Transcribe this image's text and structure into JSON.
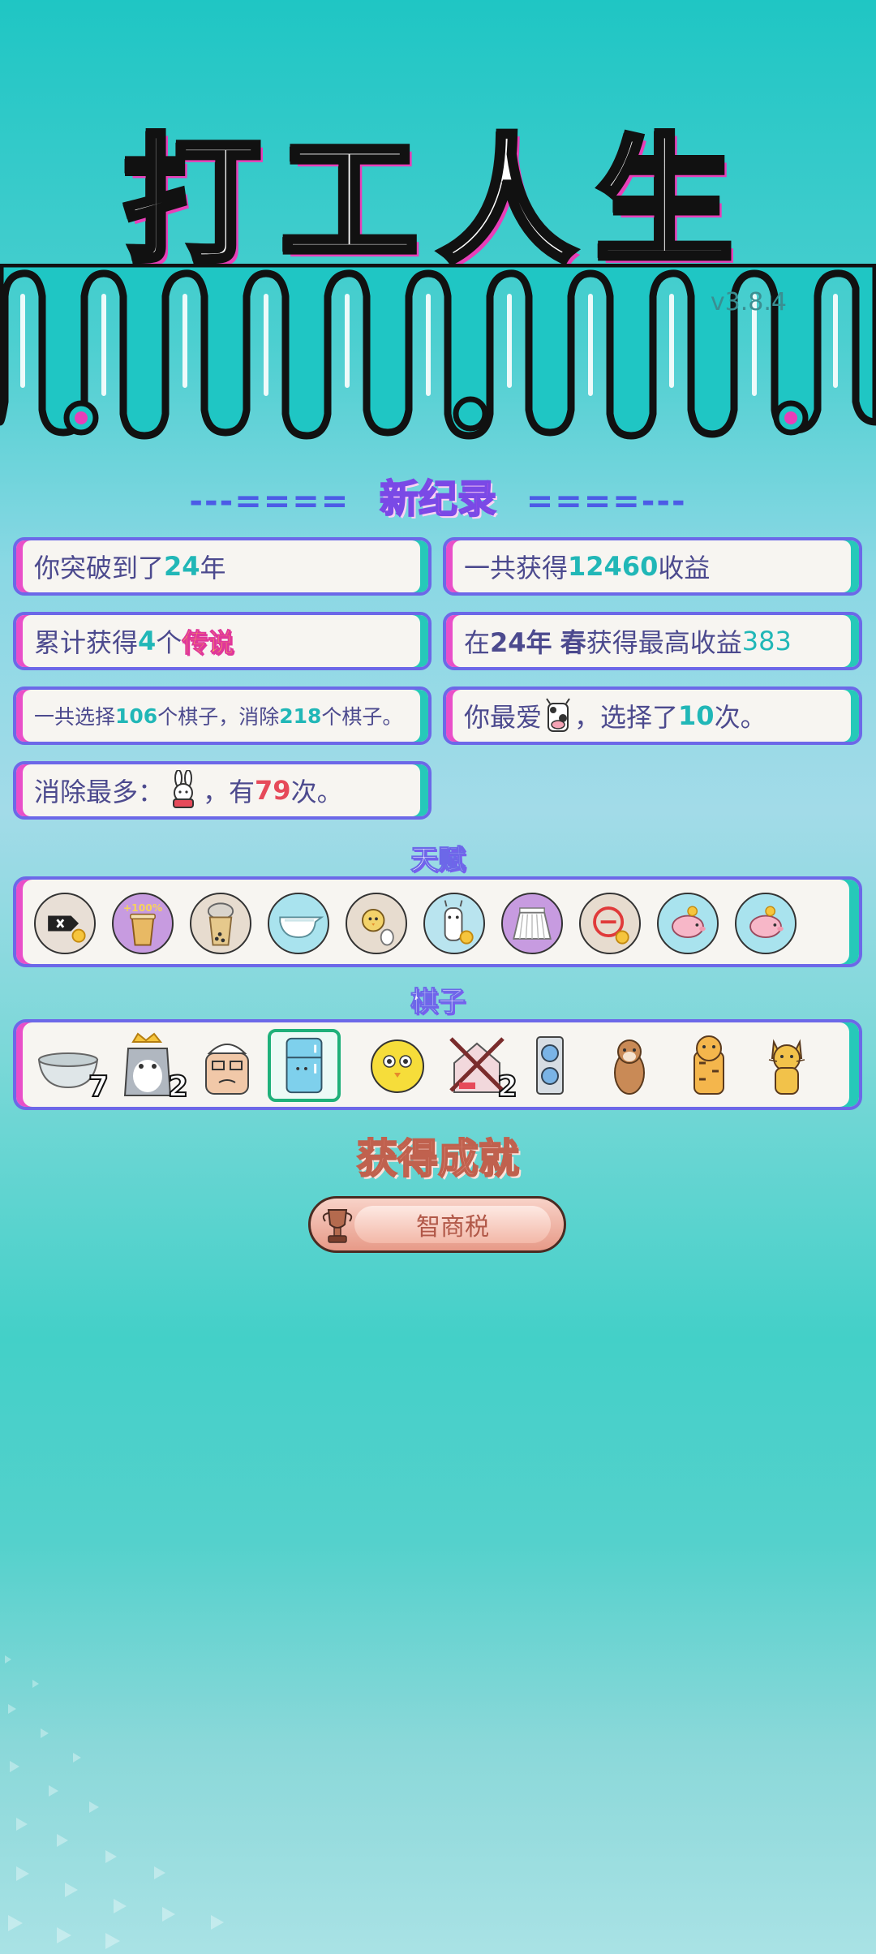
{
  "game_title": "打工人生",
  "version": "v3.8.4",
  "record_header": {
    "left_deco": "---====",
    "title": "新纪录",
    "right_deco": "====---"
  },
  "stats": {
    "years": {
      "prefix": "你突破到了",
      "value": "24",
      "suffix": "年"
    },
    "income": {
      "prefix": "一共获得",
      "value": "12460",
      "suffix": "收益"
    },
    "legend": {
      "prefix": "累计获得",
      "value": "4",
      "mid": "个",
      "tag": "传说"
    },
    "best": {
      "prefix": "在 ",
      "year": "24年",
      "season": "春",
      "mid": " 获得最高收益",
      "value": "383"
    },
    "choices": {
      "p1": "一共选择",
      "v1": "106",
      "p2": "个棋子，消除",
      "v2": "218",
      "p3": "个棋子。"
    },
    "favorite": {
      "prefix": "你最爱",
      "icon": "cow-icon",
      "mid": "，选择了",
      "value": "10",
      "suffix": "次。"
    },
    "removed": {
      "prefix": "消除最多：",
      "icon": "rabbit-icon",
      "mid": "，有",
      "value": "79",
      "suffix": "次。"
    }
  },
  "talents_label": "天赋",
  "talents": [
    "remove-tag-icon",
    "cup-plus100-icon",
    "milk-tea-icon",
    "gravy-boat-icon",
    "chick-egg-icon",
    "alpaca-icon",
    "skirt-icon",
    "minus-circle-icon",
    "piggy-bank-icon",
    "piggy-bank-icon"
  ],
  "pieces_label": "棋子",
  "pieces": [
    {
      "icon": "bowl-icon",
      "count": "7"
    },
    {
      "icon": "husky-king-icon",
      "count": "2"
    },
    {
      "icon": "worker-icon",
      "count": ""
    },
    {
      "icon": "fridge-icon",
      "count": "",
      "selected": true
    },
    {
      "icon": "chick-face-icon",
      "count": ""
    },
    {
      "icon": "crossed-house-icon",
      "count": "2"
    },
    {
      "icon": "graphics-card-icon",
      "count": ""
    },
    {
      "icon": "otter-icon",
      "count": ""
    },
    {
      "icon": "tiger-icon",
      "count": ""
    },
    {
      "icon": "cat-icon",
      "count": ""
    }
  ],
  "achievement_title": "获得成就",
  "achievement_badge": "智商税",
  "colors": {
    "accent_teal": "#21b7b7",
    "accent_purple": "#6c68e8",
    "accent_pink": "#e94fc9",
    "highlight_red": "#e64a5a"
  }
}
